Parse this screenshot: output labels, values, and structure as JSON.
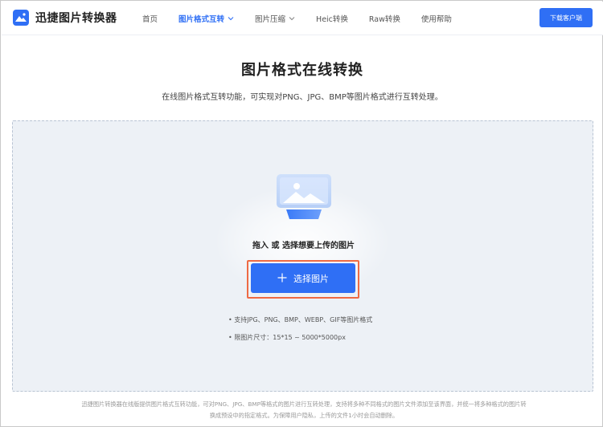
{
  "header": {
    "logo_text": "迅捷图片转换器",
    "nav": [
      {
        "label": "首页",
        "active": false,
        "dropdown": false
      },
      {
        "label": "图片格式互转",
        "active": true,
        "dropdown": true
      },
      {
        "label": "图片压缩",
        "active": false,
        "dropdown": true
      },
      {
        "label": "Heic转换",
        "active": false,
        "dropdown": false
      },
      {
        "label": "Raw转换",
        "active": false,
        "dropdown": false
      },
      {
        "label": "使用帮助",
        "active": false,
        "dropdown": false
      }
    ],
    "download_button": "下载客户端"
  },
  "main": {
    "title": "图片格式在线转换",
    "subtitle": "在线图片格式互转功能，可实现对PNG、JPG、BMP等图片格式进行互转处理。"
  },
  "upload": {
    "hint": "拖入 或 选择想要上传的图片",
    "button_label": "选择图片",
    "tips": [
      "• 支持JPG、PNG、BMP、WEBP、GIF等图片格式",
      "• 限图片尺寸：15*15 ~ 5000*5000px"
    ]
  },
  "footer": {
    "line1": "迅捷图片转换器在线版提供图片格式互转功能，可对PNG、JPG、BMP等格式的图片进行互转处理，支持将多种不同格式的图片文件添加至该界面，并统一将多种格式的图片转",
    "line2": "换成预设中的指定格式。为保障用户隐私，上传的文件1小时会自动删除。"
  },
  "colors": {
    "accent": "#2f6ff5",
    "highlight_outline": "#ee6a44",
    "dropzone_bg": "#edf1f6"
  },
  "icons": {
    "logo": "image-logo-icon",
    "chevron": "chevron-down-icon",
    "plus": "plus-icon",
    "upload_illustration": "image-upload-icon"
  }
}
